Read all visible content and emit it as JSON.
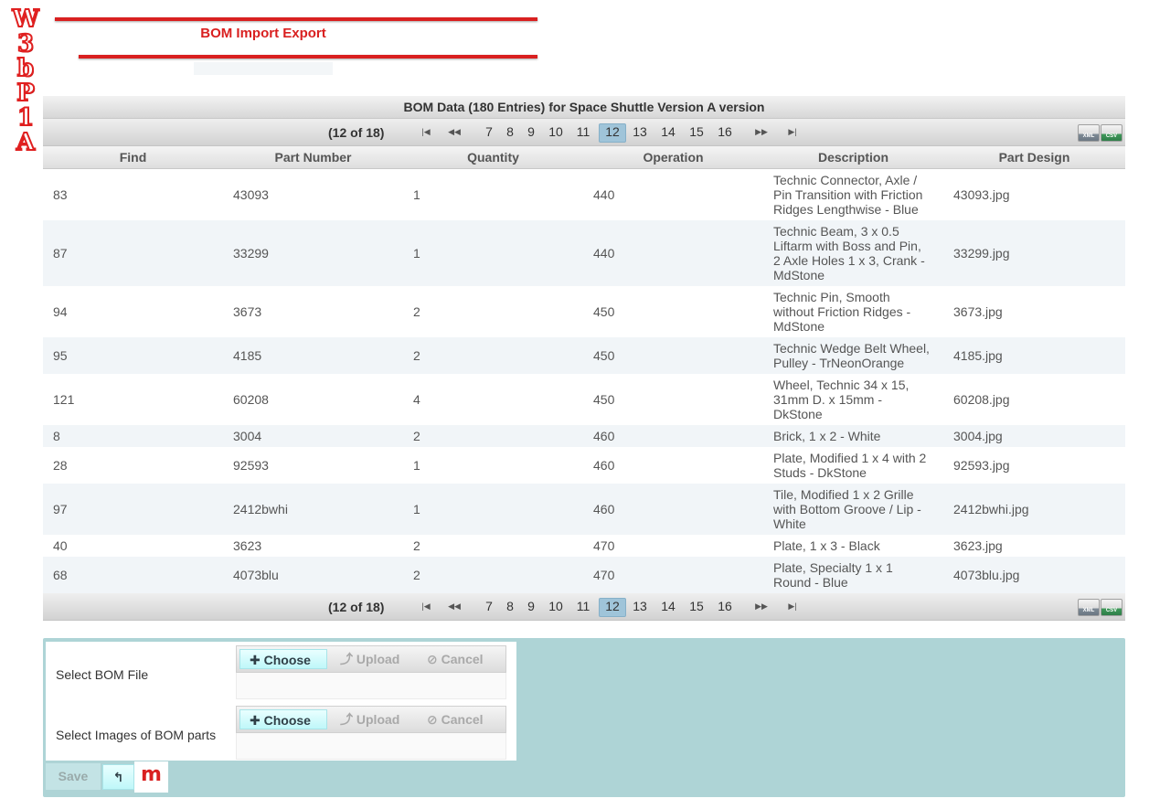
{
  "logo": {
    "letters": [
      "W",
      "3",
      "b",
      "P",
      "1",
      "A"
    ]
  },
  "header": {
    "title": "BOM Import Export"
  },
  "grid": {
    "caption": "BOM Data (180 Entries) for Space Shuttle Version A version",
    "pager": {
      "report": "(12 of 18)",
      "first_icon": "first-page-icon",
      "prev_icon": "prev-page-icon",
      "next_icon": "next-page-icon",
      "last_icon": "last-page-icon",
      "pages": [
        "7",
        "8",
        "9",
        "10",
        "11",
        "12",
        "13",
        "14",
        "15",
        "16"
      ],
      "active_page": "12",
      "export_xml": "XML",
      "export_csv": "CSV"
    },
    "columns": [
      "Find",
      "Part Number",
      "Quantity",
      "Operation",
      "Description",
      "Part Design"
    ],
    "rows": [
      {
        "find": "83",
        "part": "43093",
        "qty": "1",
        "op": "440",
        "desc": "Technic Connector, Axle / Pin Transition with Friction Ridges Lengthwise - Blue",
        "design": "43093.jpg"
      },
      {
        "find": "87",
        "part": "33299",
        "qty": "1",
        "op": "440",
        "desc": "Technic Beam, 3 x 0.5 Liftarm with Boss and Pin, 2 Axle Holes 1 x 3, Crank - MdStone",
        "design": "33299.jpg"
      },
      {
        "find": "94",
        "part": "3673",
        "qty": "2",
        "op": "450",
        "desc": "Technic Pin, Smooth without Friction Ridges - MdStone",
        "design": "3673.jpg"
      },
      {
        "find": "95",
        "part": "4185",
        "qty": "2",
        "op": "450",
        "desc": "Technic Wedge Belt Wheel, Pulley - TrNeonOrange",
        "design": "4185.jpg"
      },
      {
        "find": "121",
        "part": "60208",
        "qty": "4",
        "op": "450",
        "desc": "Wheel, Technic 34 x 15, 31mm D. x 15mm - DkStone",
        "design": "60208.jpg"
      },
      {
        "find": "8",
        "part": "3004",
        "qty": "2",
        "op": "460",
        "desc": "Brick, 1 x 2 - White",
        "design": "3004.jpg"
      },
      {
        "find": "28",
        "part": "92593",
        "qty": "1",
        "op": "460",
        "desc": "Plate, Modified 1 x 4 with 2 Studs - DkStone",
        "design": "92593.jpg"
      },
      {
        "find": "97",
        "part": "2412bwhi",
        "qty": "1",
        "op": "460",
        "desc": "Tile, Modified 1 x 2 Grille with Bottom Groove / Lip - White",
        "design": "2412bwhi.jpg"
      },
      {
        "find": "40",
        "part": "3623",
        "qty": "2",
        "op": "470",
        "desc": "Plate, 1 x 3 - Black",
        "design": "3623.jpg"
      },
      {
        "find": "68",
        "part": "4073blu",
        "qty": "2",
        "op": "470",
        "desc": "Plate, Specialty 1 x 1 Round - Blue",
        "design": "4073blu.jpg"
      }
    ]
  },
  "form": {
    "bom_file_label": "Select BOM File",
    "images_label": "Select Images of BOM parts",
    "choose_label": "Choose",
    "upload_label": "Upload",
    "cancel_label": "Cancel",
    "save_label": "Save",
    "badge_label": "m"
  },
  "colors": {
    "brand_red": "#d92020",
    "panel_teal": "#aed4d6",
    "active_page": "#9fc4d9"
  }
}
